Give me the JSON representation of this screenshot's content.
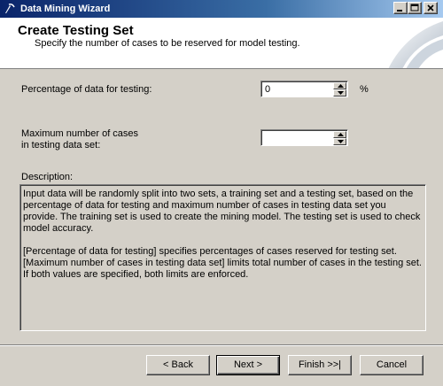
{
  "window": {
    "title": "Data Mining Wizard",
    "title_bar_gradient_start": "#0a246a",
    "title_bar_gradient_end": "#a6caf0",
    "controls": [
      "minimize-icon",
      "maximize-icon",
      "close-icon"
    ]
  },
  "header": {
    "title": "Create Testing Set",
    "subtitle": "Specify the number of cases to be reserved for model testing."
  },
  "form": {
    "percentage_label": "Percentage of data for testing:",
    "percentage_value": "0",
    "percentage_unit": "%",
    "max_cases_label_line1": "Maximum number of cases",
    "max_cases_label_line2": "in testing data set:",
    "max_cases_value": ""
  },
  "description": {
    "label": "Description:",
    "text": "Input data will be randomly split into two sets, a training set and a testing set, based on the percentage of data for testing and maximum number of cases in testing data set you provide. The training set is used to create the mining model. The testing set is used to check model accuracy.\n\n[Percentage of data for testing] specifies percentages of cases reserved for testing set.\n[Maximum number of cases in testing data set] limits total number of cases in the testing set.\nIf both values are specified, both limits are enforced."
  },
  "buttons": {
    "back": "< Back",
    "next": "Next >",
    "finish": "Finish >>|",
    "cancel": "Cancel"
  }
}
